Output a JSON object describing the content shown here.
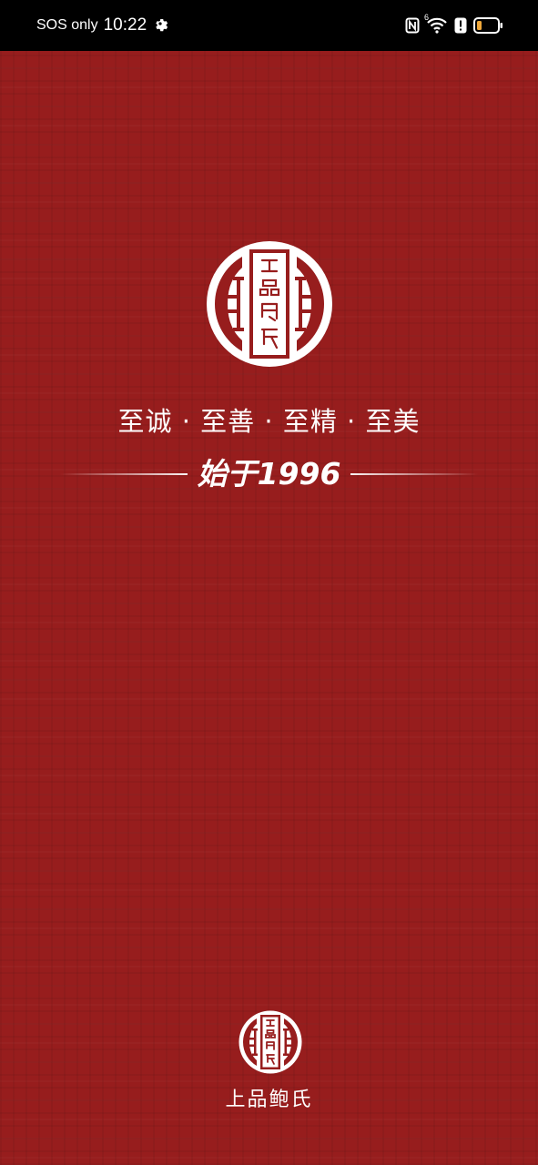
{
  "status_bar": {
    "carrier_text": "SOS only",
    "time": "10:22",
    "network_badge": "6",
    "icons": [
      "gear-icon",
      "nfc-icon",
      "wifi-icon",
      "alert-icon",
      "battery-icon"
    ]
  },
  "splash": {
    "motto": "至诚 · 至善 · 至精 · 至美",
    "since_text": "始于1996",
    "brand_name": "上品鲍氏"
  },
  "colors": {
    "background": "#971d1d",
    "status_bar": "#000000",
    "foreground": "#ffffff",
    "battery_level": "#f0a83a"
  }
}
